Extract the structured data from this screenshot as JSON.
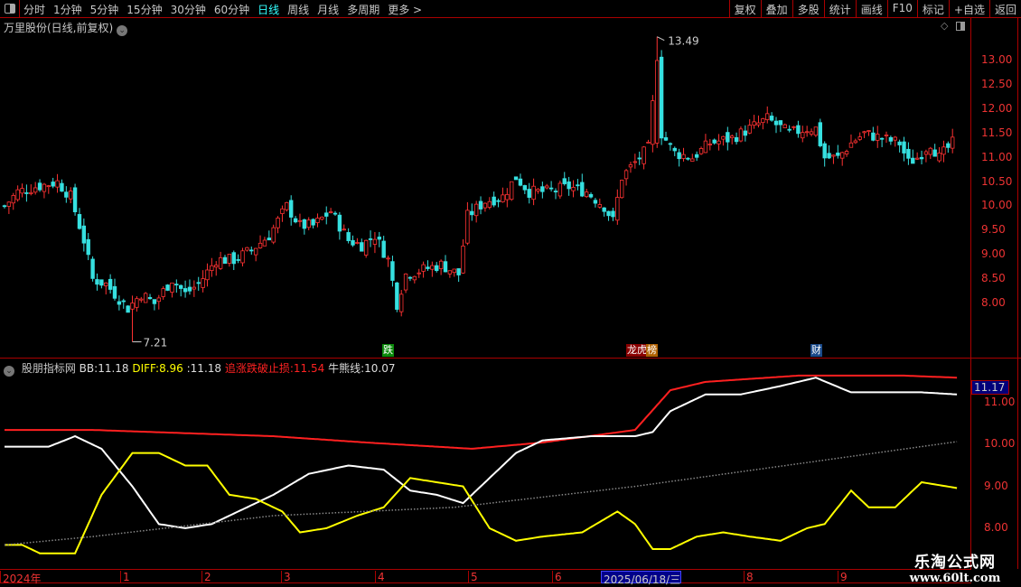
{
  "toolbar": {
    "periods": [
      "分时",
      "1分钟",
      "5分钟",
      "15分钟",
      "30分钟",
      "60分钟",
      "日线",
      "周线",
      "月线",
      "多周期",
      "更多 >"
    ],
    "active_period": "日线",
    "buttons": [
      "复权",
      "叠加",
      "多股",
      "统计",
      "画线",
      "F10",
      "标记",
      "+自选",
      "返回"
    ]
  },
  "title": "万里股份(日线,前复权)",
  "price_axis": [
    "13.00",
    "12.50",
    "12.00",
    "11.50",
    "11.00",
    "10.50",
    "10.00",
    "9.50",
    "9.00",
    "8.50",
    "8.00"
  ],
  "annotations": {
    "high": "13.49",
    "low": "7.21"
  },
  "markers": [
    {
      "label": "跌",
      "color": "#0a8a0a"
    },
    {
      "label": "龙虎榜",
      "short": "榜",
      "color": "#b06000"
    },
    {
      "label": "财",
      "color": "#1a4a8a"
    }
  ],
  "indicator": {
    "name": "股朋指标网",
    "bb_label": "BB:",
    "bb": "11.18",
    "diff_label": "DIFF:",
    "diff": "8.96",
    "unnamed_label": ":",
    "unnamed": "11.18",
    "stop_label": "追涨跌破止损:",
    "stop": "11.54",
    "bull_label": "牛熊线:",
    "bull": "10.07",
    "axis": [
      "11.00",
      "10.00",
      "9.00",
      "8.00"
    ],
    "current": "11.17"
  },
  "date_axis": [
    "2024年",
    "1",
    "2",
    "3",
    "4",
    "5",
    "6",
    "2025/06/18/三",
    "8",
    "9"
  ],
  "watermark": {
    "name": "乐淘公式网",
    "url": "www.60lt.com"
  },
  "chart_data": {
    "type": "candlestick",
    "price_range": [
      7.0,
      13.6
    ],
    "close_waypoints": [
      [
        0,
        10.0
      ],
      [
        3,
        10.3
      ],
      [
        7,
        10.4
      ],
      [
        12,
        10.5
      ],
      [
        15,
        10.2
      ],
      [
        18,
        9.3
      ],
      [
        20,
        8.5
      ],
      [
        23,
        8.4
      ],
      [
        28,
        7.9
      ],
      [
        31,
        8.2
      ],
      [
        34,
        8.0
      ],
      [
        38,
        8.5
      ],
      [
        41,
        8.2
      ],
      [
        44,
        8.4
      ],
      [
        48,
        8.9
      ],
      [
        52,
        8.9
      ],
      [
        56,
        9.1
      ],
      [
        60,
        9.4
      ],
      [
        64,
        10.0
      ],
      [
        67,
        9.6
      ],
      [
        70,
        9.6
      ],
      [
        74,
        9.9
      ],
      [
        78,
        9.3
      ],
      [
        81,
        9.2
      ],
      [
        84,
        9.4
      ],
      [
        87,
        8.9
      ],
      [
        89,
        8.0
      ],
      [
        91,
        8.6
      ],
      [
        95,
        8.7
      ],
      [
        99,
        8.8
      ],
      [
        103,
        8.6
      ],
      [
        105,
        9.8
      ],
      [
        109,
        10.1
      ],
      [
        113,
        10.2
      ],
      [
        116,
        10.6
      ],
      [
        119,
        10.3
      ],
      [
        123,
        10.3
      ],
      [
        128,
        10.4
      ],
      [
        132,
        10.3
      ],
      [
        136,
        10.0
      ],
      [
        138,
        9.7
      ],
      [
        140,
        10.6
      ],
      [
        144,
        11.0
      ],
      [
        146,
        11.2
      ],
      [
        148,
        13.0
      ],
      [
        149,
        11.5
      ],
      [
        152,
        11.1
      ],
      [
        156,
        11.0
      ],
      [
        160,
        11.3
      ],
      [
        165,
        11.4
      ],
      [
        169,
        11.6
      ],
      [
        173,
        11.8
      ],
      [
        178,
        11.5
      ],
      [
        182,
        11.6
      ],
      [
        184,
        11.6
      ],
      [
        186,
        11.0
      ],
      [
        189,
        11.0
      ],
      [
        192,
        11.3
      ],
      [
        195,
        11.5
      ],
      [
        199,
        11.4
      ],
      [
        203,
        11.3
      ],
      [
        205,
        10.9
      ],
      [
        207,
        11.0
      ],
      [
        210,
        11.3
      ],
      [
        212,
        11.0
      ],
      [
        215,
        11.3
      ]
    ],
    "high_day": 148,
    "high": 13.49,
    "low_day": 29,
    "low": 7.21,
    "indicator_range": [
      7.2,
      11.9
    ],
    "series": [
      {
        "name": "追涨跌破止损",
        "color": "#ff2020",
        "points": [
          [
            0,
            10.35
          ],
          [
            20,
            10.35
          ],
          [
            61,
            10.2
          ],
          [
            82,
            10.05
          ],
          [
            106,
            9.9
          ],
          [
            122,
            10.05
          ],
          [
            143,
            10.35
          ],
          [
            151,
            11.3
          ],
          [
            159,
            11.5
          ],
          [
            180,
            11.65
          ],
          [
            204,
            11.65
          ],
          [
            216,
            11.6
          ]
        ]
      },
      {
        "name": "BB",
        "color": "#ffffff",
        "points": [
          [
            0,
            9.95
          ],
          [
            10,
            9.95
          ],
          [
            16,
            10.2
          ],
          [
            22,
            9.9
          ],
          [
            29,
            9.0
          ],
          [
            35,
            8.1
          ],
          [
            41,
            8.0
          ],
          [
            47,
            8.1
          ],
          [
            53,
            8.4
          ],
          [
            61,
            8.8
          ],
          [
            69,
            9.3
          ],
          [
            78,
            9.5
          ],
          [
            86,
            9.4
          ],
          [
            92,
            8.9
          ],
          [
            98,
            8.8
          ],
          [
            104,
            8.6
          ],
          [
            110,
            9.2
          ],
          [
            116,
            9.8
          ],
          [
            122,
            10.1
          ],
          [
            133,
            10.2
          ],
          [
            143,
            10.2
          ],
          [
            147,
            10.3
          ],
          [
            151,
            10.8
          ],
          [
            159,
            11.2
          ],
          [
            167,
            11.2
          ],
          [
            176,
            11.4
          ],
          [
            184,
            11.6
          ],
          [
            192,
            11.25
          ],
          [
            200,
            11.25
          ],
          [
            208,
            11.25
          ],
          [
            216,
            11.2
          ]
        ]
      },
      {
        "name": "DIFF",
        "color": "#ffff00",
        "points": [
          [
            0,
            7.6
          ],
          [
            4,
            7.6
          ],
          [
            8,
            7.4
          ],
          [
            16,
            7.4
          ],
          [
            22,
            8.8
          ],
          [
            29,
            9.8
          ],
          [
            35,
            9.8
          ],
          [
            41,
            9.5
          ],
          [
            46,
            9.5
          ],
          [
            51,
            8.8
          ],
          [
            57,
            8.7
          ],
          [
            63,
            8.4
          ],
          [
            67,
            7.9
          ],
          [
            73,
            8.0
          ],
          [
            80,
            8.3
          ],
          [
            86,
            8.5
          ],
          [
            92,
            9.2
          ],
          [
            98,
            9.1
          ],
          [
            104,
            9.0
          ],
          [
            110,
            8.0
          ],
          [
            116,
            7.7
          ],
          [
            122,
            7.8
          ],
          [
            131,
            7.9
          ],
          [
            139,
            8.4
          ],
          [
            143,
            8.1
          ],
          [
            147,
            7.5
          ],
          [
            151,
            7.5
          ],
          [
            157,
            7.8
          ],
          [
            163,
            7.9
          ],
          [
            169,
            7.8
          ],
          [
            176,
            7.7
          ],
          [
            182,
            8.0
          ],
          [
            186,
            8.1
          ],
          [
            192,
            8.9
          ],
          [
            196,
            8.5
          ],
          [
            202,
            8.5
          ],
          [
            208,
            9.1
          ],
          [
            216,
            8.96
          ]
        ]
      },
      {
        "name": "牛熊线",
        "color": "#888888",
        "dotted": true,
        "points": [
          [
            0,
            7.6
          ],
          [
            20,
            7.8
          ],
          [
            61,
            8.3
          ],
          [
            102,
            8.5
          ],
          [
            143,
            9.0
          ],
          [
            184,
            9.6
          ],
          [
            216,
            10.07
          ]
        ]
      }
    ]
  }
}
